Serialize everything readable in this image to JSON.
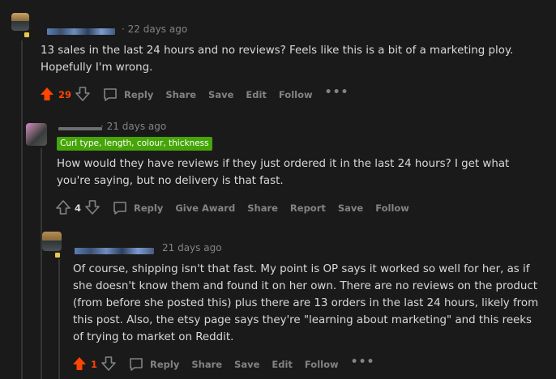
{
  "colors": {
    "upvote_active": "#ff4500",
    "muted": "#818384",
    "text": "#d7dadc",
    "flair_bg": "#46a508",
    "background": "#1a1a1b"
  },
  "comments": [
    {
      "timestamp": "22 days ago",
      "text": "13 sales in the last 24 hours and no reviews? Feels like this is a bit of a marketing ploy. Hopefully I'm wrong.",
      "score": "29",
      "upvoted": true,
      "actions": [
        "Reply",
        "Share",
        "Save",
        "Edit",
        "Follow"
      ],
      "more": "•••"
    },
    {
      "username_fragment": "·",
      "timestamp": "21 days ago",
      "flair": "Curl type, length, colour, thickness",
      "text": "How would they have reviews if they just ordered it in the last 24 hours? I get what you're saying, but no delivery is that fast.",
      "score": "4",
      "upvoted": false,
      "actions": [
        "Reply",
        "Give Award",
        "Share",
        "Report",
        "Save",
        "Follow"
      ]
    },
    {
      "timestamp": "21 days ago",
      "text": "Of course, shipping isn't that fast. My point is OP says it worked so well for her, as if she doesn't know them and found it on her own. There are no reviews on the product (from before she posted this) plus there are 13 orders in the last 24 hours, likely from this post. Also, the etsy page says they're \"learning about marketing\" and this reeks of trying to market on Reddit.",
      "score": "1",
      "upvoted": true,
      "actions": [
        "Reply",
        "Share",
        "Save",
        "Edit",
        "Follow"
      ],
      "more": "•••"
    }
  ]
}
